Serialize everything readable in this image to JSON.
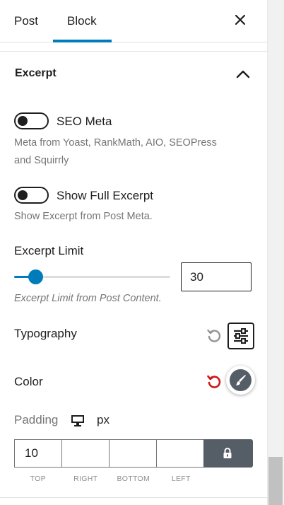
{
  "tabs": {
    "post": "Post",
    "block": "Block"
  },
  "section": {
    "title": "Excerpt"
  },
  "seo_meta": {
    "label": "SEO Meta",
    "enabled": false,
    "help_line1": "Meta from Yoast, RankMath, AIO, SEOPress",
    "help_line2": "and Squirrly"
  },
  "full_excerpt": {
    "label": "Show Full Excerpt",
    "enabled": false,
    "help": "Show Excerpt from Post Meta."
  },
  "excerpt_limit": {
    "label": "Excerpt Limit",
    "value": "30",
    "slider_fraction": 0.14,
    "help": "Excerpt Limit from Post Content."
  },
  "typography": {
    "label": "Typography"
  },
  "color": {
    "label": "Color"
  },
  "padding": {
    "label": "Padding",
    "unit": "px",
    "top": "10",
    "right": "",
    "bottom": "",
    "left": "",
    "side_labels": {
      "top": "TOP",
      "right": "RIGHT",
      "bottom": "BOTTOM",
      "left": "LEFT"
    }
  },
  "colors": {
    "accent": "#007cba",
    "reset_active": "#cc1818",
    "reset_inactive": "#949494",
    "dark": "#1e1e1e"
  },
  "icons": {
    "close": "close-icon",
    "chevron": "chevron-up-icon",
    "typography_reset": "reset-icon",
    "typography_settings": "settings-sliders-icon",
    "color_reset": "reset-icon",
    "color_picker": "brush-icon",
    "device": "desktop-icon",
    "lock": "lock-icon"
  }
}
